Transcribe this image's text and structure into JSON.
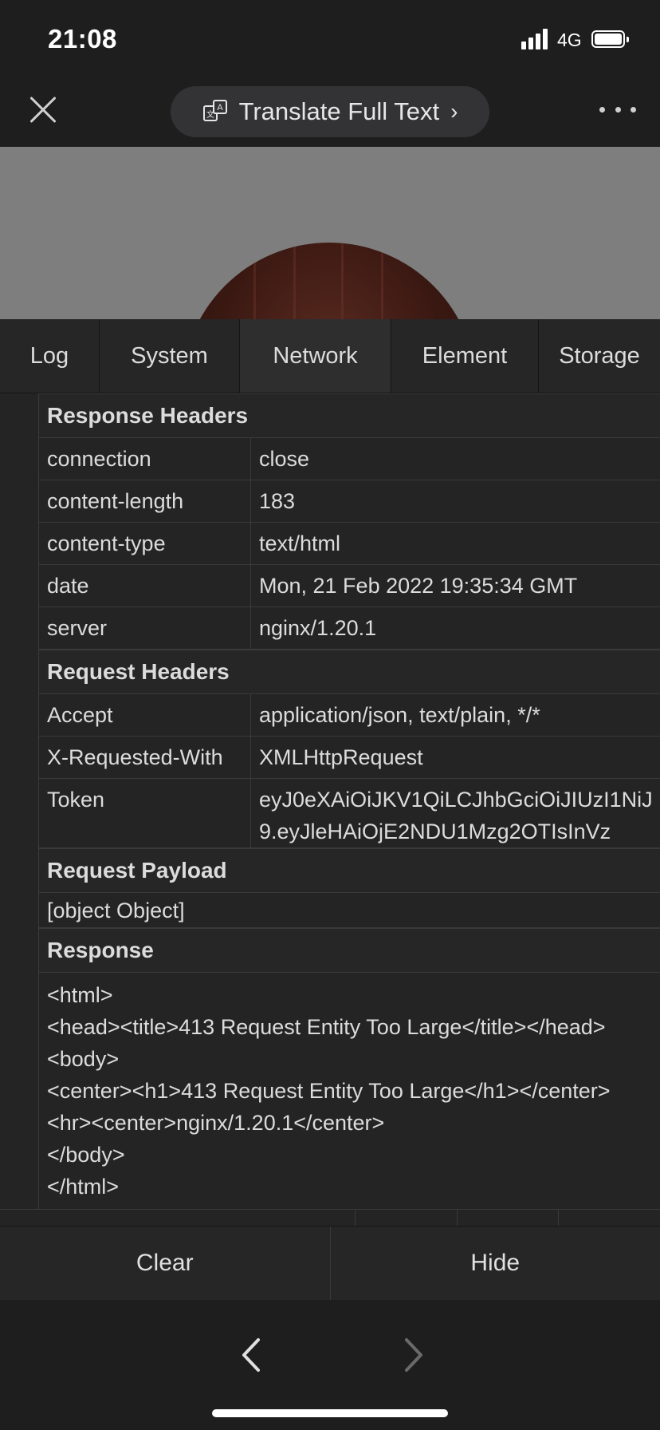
{
  "status": {
    "time": "21:08",
    "network": "4G"
  },
  "nav": {
    "translate_label": "Translate Full Text",
    "translate_chevron": "›"
  },
  "tabs": [
    {
      "label": "Log",
      "active": false
    },
    {
      "label": "System",
      "active": false
    },
    {
      "label": "Network",
      "active": true
    },
    {
      "label": "Element",
      "active": false
    },
    {
      "label": "Storage",
      "active": false
    }
  ],
  "response_headers": {
    "title": "Response Headers",
    "rows": [
      {
        "key": "connection",
        "value": "close"
      },
      {
        "key": "content-length",
        "value": "183"
      },
      {
        "key": "content-type",
        "value": "text/html"
      },
      {
        "key": "date",
        "value": "Mon, 21 Feb 2022 19:35:34 GMT"
      },
      {
        "key": "server",
        "value": "nginx/1.20.1"
      }
    ]
  },
  "request_headers": {
    "title": "Request Headers",
    "rows": [
      {
        "key": "Accept",
        "value": "application/json, text/plain, */*"
      },
      {
        "key": "X-Requested-With",
        "value": "XMLHttpRequest"
      },
      {
        "key": "Token",
        "value": "eyJ0eXAiOiJKV1QiLCJhbGciOiJIUzI1NiJ9.eyJleHAiOjE2NDU1Mzg2OTIsInVz"
      }
    ]
  },
  "request_payload": {
    "title": "Request Payload",
    "value": "[object Object]"
  },
  "response": {
    "title": "Response",
    "body": "<html>\n<head><title>413 Request Entity Too Large</title></head>\n<body>\n<center><h1>413 Request Entity Too Large</h1></center>\n<hr><center>nginx/1.20.1</center>\n</body>\n</html>"
  },
  "actions": {
    "clear": "Clear",
    "hide": "Hide"
  },
  "colors": {
    "background": "#1e1e1e",
    "panel": "#242424",
    "tab_bar": "#262626",
    "text": "#dcdcdc",
    "pill": "#333335"
  }
}
